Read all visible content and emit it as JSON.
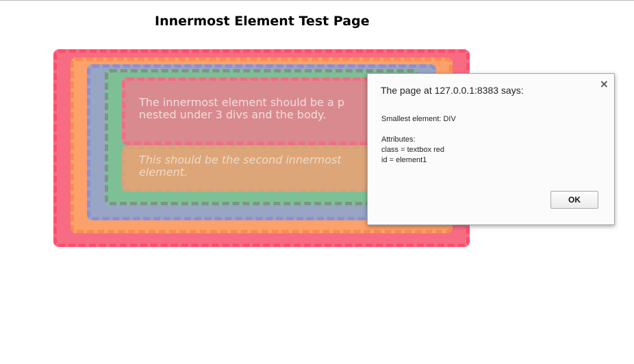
{
  "page": {
    "title": "Innermost Element Test Page",
    "first_text": "The innermost element should be a p\nnested under 3 divs and the body.",
    "second_text": "This should be the second innermost\nelement."
  },
  "dialog": {
    "title": "The page at 127.0.0.1:8383 says:",
    "message": "Smallest element: DIV\n\nAttributes:\nclass = textbox red\nid = element1",
    "ok_label": "OK",
    "close_symbol": "×"
  }
}
